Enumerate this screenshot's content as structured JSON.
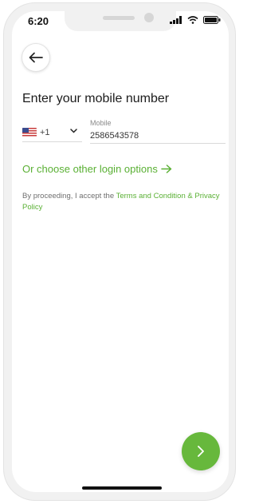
{
  "status_bar": {
    "time": "6:20",
    "icons": [
      "signal-icon",
      "wifi-icon",
      "battery-icon"
    ]
  },
  "header": {
    "back_icon": "arrow-left-icon"
  },
  "main": {
    "title": "Enter your mobile number",
    "country": {
      "flag_icon": "us-flag-icon",
      "dial_code": "+1"
    },
    "mobile": {
      "label": "Mobile",
      "value": "2586543578"
    },
    "other_options": {
      "label": "Or choose other login options",
      "icon": "arrow-right-icon"
    },
    "terms": {
      "prefix": "By proceeding, I accept the ",
      "link1": "Terms and Condition",
      "joiner": " & ",
      "link2": "Privacy Policy"
    }
  },
  "footer": {
    "next_icon": "chevron-right-icon"
  },
  "colors": {
    "accent": "#5ab034",
    "fab": "#67b83c",
    "text": "#1c1c1c"
  }
}
